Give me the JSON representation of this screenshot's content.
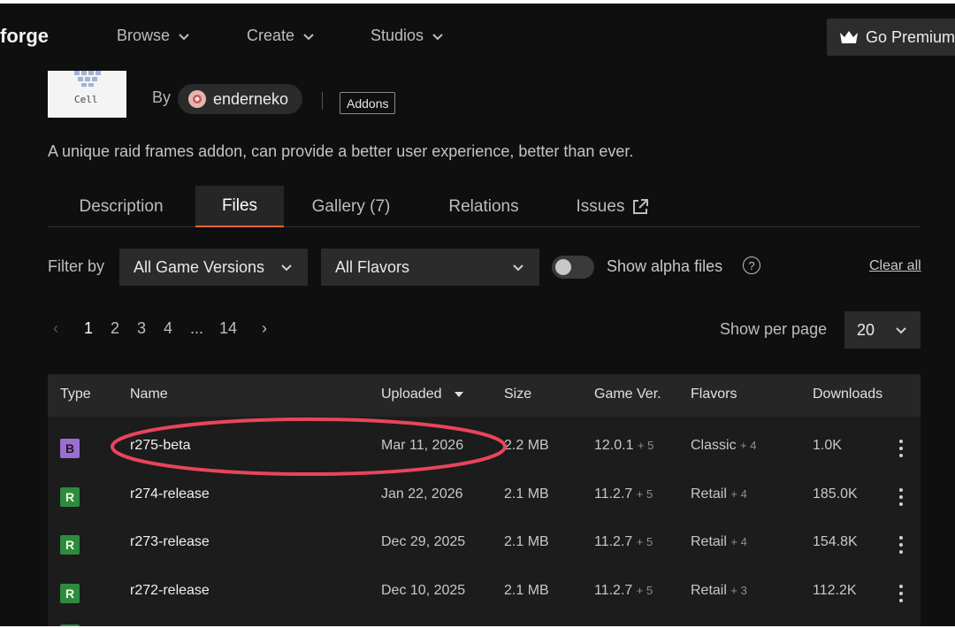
{
  "nav": {
    "brand": "forge",
    "items": [
      {
        "label": "Browse"
      },
      {
        "label": "Create"
      },
      {
        "label": "Studios"
      }
    ],
    "premium_label": "Go Premium"
  },
  "project": {
    "thumb_text": "Cell",
    "by_label": "By",
    "author": "enderneko",
    "category_tag": "Addons",
    "summary": "A unique raid frames addon, can provide a better user experience, better than ever."
  },
  "tabs": [
    {
      "label": "Description",
      "active": false
    },
    {
      "label": "Files",
      "active": true
    },
    {
      "label": "Gallery (7)",
      "active": false
    },
    {
      "label": "Relations",
      "active": false
    },
    {
      "label": "Issues",
      "active": false
    }
  ],
  "filters": {
    "label": "Filter by",
    "game_version": "All Game Versions",
    "flavor": "All Flavors",
    "alpha_label": "Show alpha files",
    "alpha_enabled": false,
    "help_glyph": "?",
    "clear_label": "Clear all"
  },
  "pagination": {
    "prev": "‹",
    "pages": [
      "1",
      "2",
      "3",
      "4",
      "...",
      "14"
    ],
    "current": "1",
    "next": "›",
    "per_page_label": "Show per page",
    "per_page_value": "20"
  },
  "table": {
    "headers": {
      "type": "Type",
      "name": "Name",
      "uploaded": "Uploaded",
      "size": "Size",
      "game_ver": "Game Ver.",
      "flavors": "Flavors",
      "downloads": "Downloads"
    },
    "rows": [
      {
        "type": "B",
        "name": "r275-beta",
        "uploaded": "Mar 11, 2026",
        "size": "2.2 MB",
        "game_ver": "12.0.1",
        "game_ver_more": "+ 5",
        "flavor": "Classic",
        "flavor_more": "+ 4",
        "downloads": "1.0K"
      },
      {
        "type": "R",
        "name": "r274-release",
        "uploaded": "Jan 22, 2026",
        "size": "2.1 MB",
        "game_ver": "11.2.7",
        "game_ver_more": "+ 5",
        "flavor": "Retail",
        "flavor_more": "+ 4",
        "downloads": "185.0K"
      },
      {
        "type": "R",
        "name": "r273-release",
        "uploaded": "Dec 29, 2025",
        "size": "2.1 MB",
        "game_ver": "11.2.7",
        "game_ver_more": "+ 5",
        "flavor": "Retail",
        "flavor_more": "+ 4",
        "downloads": "154.8K"
      },
      {
        "type": "R",
        "name": "r272-release",
        "uploaded": "Dec 10, 2025",
        "size": "2.1 MB",
        "game_ver": "11.2.7",
        "game_ver_more": "+ 5",
        "flavor": "Retail",
        "flavor_more": "+ 3",
        "downloads": "112.2K"
      }
    ]
  },
  "colors": {
    "background": "#0f0f0f",
    "accent_tab": "#f16436",
    "beta_badge": "#9b6ed3",
    "release_badge": "#2e8b3d",
    "highlight_ring": "#e8455c"
  }
}
